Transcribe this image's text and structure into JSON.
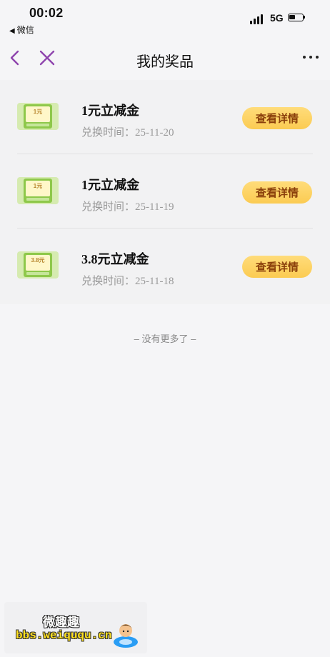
{
  "status_bar": {
    "time": "00:02",
    "back_app_label": "微信",
    "network": "5G",
    "battery_level": 0.45
  },
  "navbar": {
    "title": "我的奖品",
    "back_icon": "chevron-left-icon",
    "close_icon": "close-icon",
    "more_icon": "more-dots-icon",
    "accent_color": "#8e44ad"
  },
  "prizes": [
    {
      "thumb_label": "1元",
      "name": "1元立减金",
      "redeem_label": "兑换时间：",
      "date": "25-11-20",
      "button_label": "查看详情"
    },
    {
      "thumb_label": "1元",
      "name": "1元立减金",
      "redeem_label": "兑换时间：",
      "date": "25-11-19",
      "button_label": "查看详情"
    },
    {
      "thumb_label": "3.8元",
      "name": "3.8元立减金",
      "redeem_label": "兑换时间：",
      "date": "25-11-18",
      "button_label": "查看详情"
    }
  ],
  "footer": {
    "no_more": "– 没有更多了 –"
  },
  "watermark": {
    "line1": "微趣趣",
    "line2": "bbs.weiququ.cn"
  },
  "colors": {
    "button_bg": "#fbcb52",
    "button_text": "#8a3f0b",
    "page_bg": "#f5f5f7"
  }
}
